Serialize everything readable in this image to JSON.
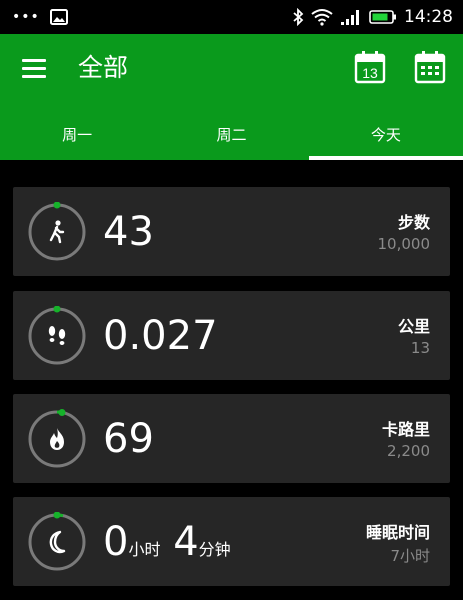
{
  "status_bar": {
    "time": "14:28",
    "icons": [
      "more-dots-icon",
      "image-icon",
      "bluetooth-icon",
      "wifi-icon",
      "signal-icon",
      "battery-icon"
    ]
  },
  "app_bar": {
    "title": "全部",
    "today_date": "13",
    "icons": [
      "menu-icon",
      "calendar-today-icon",
      "calendar-month-icon"
    ],
    "accent_color": "#0a9a1c"
  },
  "tabs": [
    {
      "label": "周一",
      "selected": false
    },
    {
      "label": "周二",
      "selected": false
    },
    {
      "label": "今天",
      "selected": true
    }
  ],
  "cards": {
    "steps": {
      "value": "43",
      "label": "步数",
      "goal": "10,000",
      "icon": "walking-person-icon"
    },
    "distance": {
      "value": "0.027",
      "label": "公里",
      "goal": "13",
      "icon": "footprints-icon"
    },
    "calories": {
      "value": "69",
      "label": "卡路里",
      "goal": "2,200",
      "icon": "flame-icon"
    },
    "sleep": {
      "hours_value": "0",
      "hours_unit": "小时",
      "minutes_value": "4",
      "minutes_unit": "分钟",
      "label": "睡眠时间",
      "goal": "7小时",
      "icon": "moon-icon"
    }
  }
}
